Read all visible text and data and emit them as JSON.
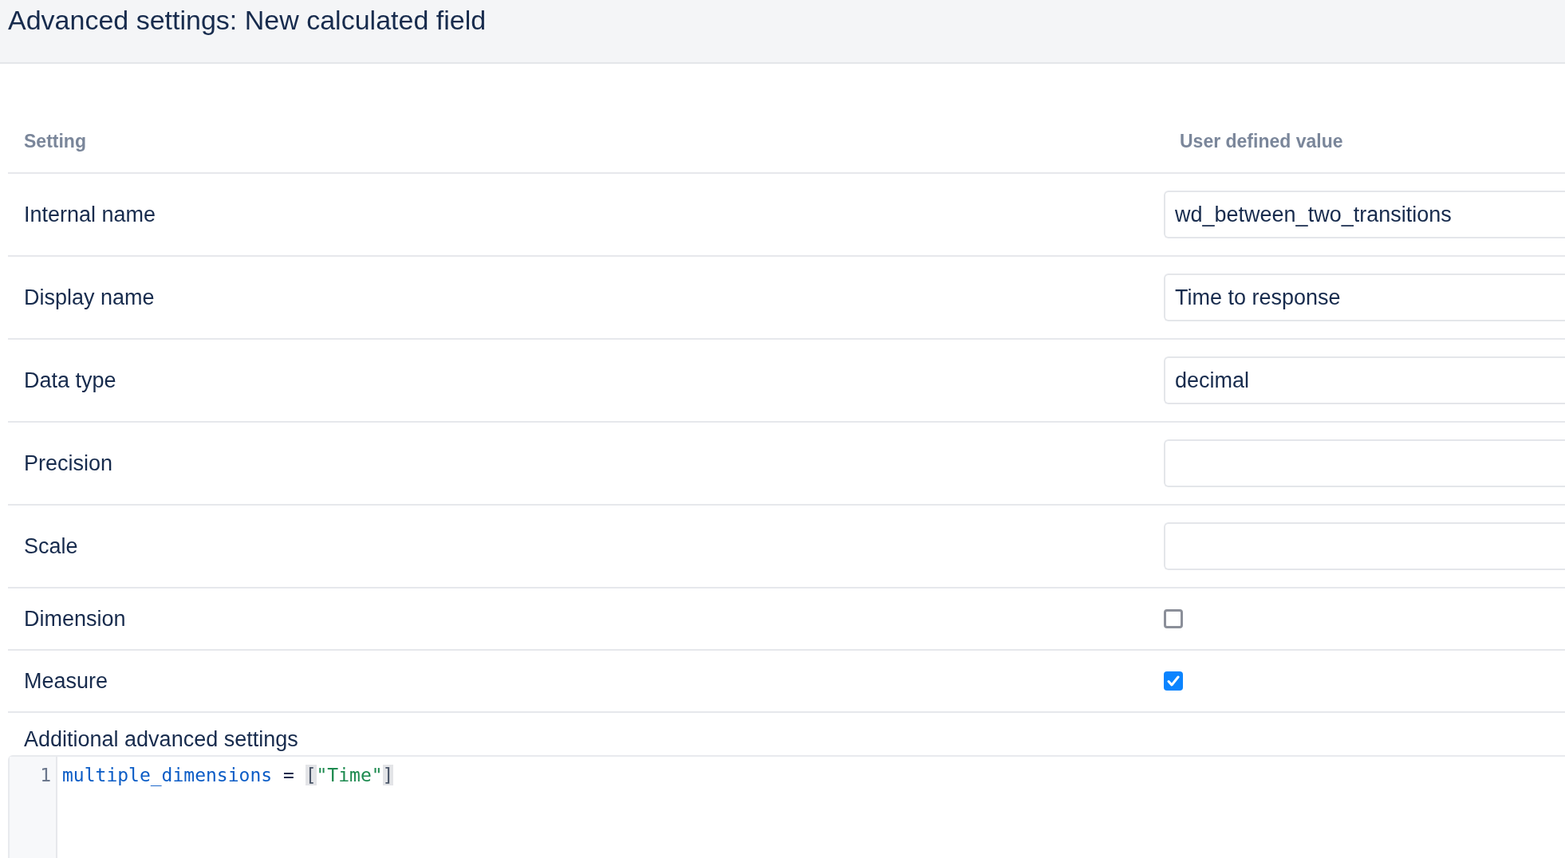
{
  "header": {
    "title": "Advanced settings: New calculated field"
  },
  "table": {
    "columns": [
      "Setting",
      "User defined value"
    ],
    "rows": [
      {
        "label": "Internal name",
        "kind": "text",
        "value": "wd_between_two_transitions"
      },
      {
        "label": "Display name",
        "kind": "text",
        "value": "Time to response"
      },
      {
        "label": "Data type",
        "kind": "text",
        "value": "decimal"
      },
      {
        "label": "Precision",
        "kind": "text"
      },
      {
        "label": "Scale",
        "kind": "text"
      },
      {
        "label": "Dimension",
        "kind": "checkbox",
        "checked": false
      },
      {
        "label": "Measure",
        "kind": "checkbox",
        "checked": true
      }
    ]
  },
  "editor": {
    "label": "Additional advanced settings",
    "lines": [
      {
        "number": "1",
        "tokens": [
          {
            "kind": "variable",
            "text": "multiple_dimensions"
          },
          {
            "kind": "operator",
            "text": " = "
          },
          {
            "kind": "bracket",
            "text": "["
          },
          {
            "kind": "string",
            "text": "\"Time\""
          },
          {
            "kind": "bracket",
            "text": "]"
          }
        ]
      }
    ]
  }
}
